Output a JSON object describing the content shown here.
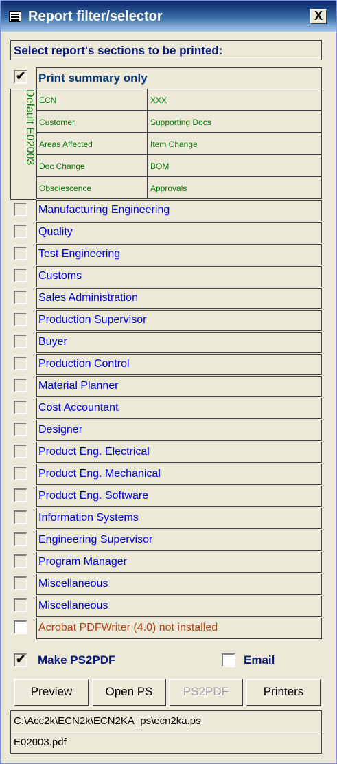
{
  "window": {
    "title": "Report filter/selector",
    "close_label": "X"
  },
  "sections_header": "Select report's sections to be printed:",
  "summary": {
    "label": "Print summary only",
    "checked": true
  },
  "default_label": "Default E02003",
  "default_grid": [
    [
      "ECN",
      "XXX"
    ],
    [
      "Customer",
      "Supporting Docs"
    ],
    [
      "Areas Affected",
      "Item Change"
    ],
    [
      "Doc Change",
      "BOM"
    ],
    [
      "Obsolescence",
      "Approvals"
    ]
  ],
  "sections": [
    "Manufacturing Engineering",
    "Quality",
    "Test Engineering",
    "Customs",
    "Sales Administration",
    "Production Supervisor",
    "Buyer",
    "Production Control",
    "Material Planner",
    "Cost Accountant",
    "Designer",
    "Product Eng. Electrical",
    "Product Eng. Mechanical",
    "Product Eng. Software",
    "Information Systems",
    "Engineering Supervisor",
    "Program Manager",
    "Miscellaneous",
    "Miscellaneous"
  ],
  "acrobat_note": "Acrobat PDFWriter (4.0) not installed",
  "options": {
    "make_ps2pdf": {
      "label": "Make PS2PDF",
      "checked": true
    },
    "email": {
      "label": "Email",
      "checked": false
    }
  },
  "buttons": {
    "preview": "Preview",
    "open_ps": "Open PS",
    "ps2pdf": "PS2PDF",
    "printers": "Printers"
  },
  "paths": {
    "ps_file": "C:\\Acc2k\\ECN2k\\ECN2KA_ps\\ecn2ka.ps",
    "pdf_file": "E02003.pdf"
  },
  "colors": {
    "title_bar": "#0a246a",
    "section_text": "#0000e0",
    "default_text": "#0a7a0a",
    "warning_text": "#b04010"
  }
}
